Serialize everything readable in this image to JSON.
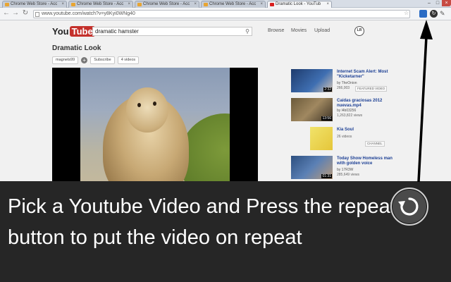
{
  "browser": {
    "tabs": [
      {
        "label": "Chrome Web Store - Acc",
        "active": false
      },
      {
        "label": "Chrome Web Store - Acc",
        "active": false
      },
      {
        "label": "Chrome Web Store - Acc",
        "active": false
      },
      {
        "label": "Chrome Web Store - Acc",
        "active": false
      },
      {
        "label": "Dramatic Look - YouTub",
        "active": true
      }
    ],
    "tab_close_glyph": "×",
    "url": "www.youtube.com/watch?v=y8Kyi0WNg40",
    "icons": {
      "back": "back-arrow-icon",
      "forward": "forward-arrow-icon",
      "reload": "reload-icon",
      "page": "page-icon",
      "bookmark": "star-icon",
      "extension1": "extension-icon",
      "extension2": "repeat-extension-icon",
      "menu": "wrench-icon"
    }
  },
  "youtube": {
    "logo_you": "You",
    "logo_tube": "Tube",
    "search_value": "dramatic hamster",
    "nav": [
      "Browse",
      "Movies",
      "Upload"
    ],
    "account_initials": "LR",
    "video_title": "Dramatic Look",
    "channel": "magnets99",
    "subscribe": "Subscribe",
    "videos_count": "4 videos",
    "related": [
      {
        "title": "Internet Scam Alert: Most \"Kicketarner\"",
        "by": "by TheOnion",
        "views": "266,003",
        "badge": "FEATURED VIDEO",
        "duration": "2:32"
      },
      {
        "title": "Caídas graciosas 2012 nuevas.mp4",
        "by": "by l4b03256",
        "views": "1,263,822 views",
        "badge": "",
        "duration": "13:56"
      },
      {
        "title": "Kia Soul",
        "by": "",
        "views": "26 videos",
        "badge": "CHANNEL",
        "duration": ""
      },
      {
        "title": "Today Show Homeless man with golden voice",
        "by": "by 17R3W",
        "views": "285,649 views",
        "badge": "",
        "duration": "01:31"
      }
    ]
  },
  "overlay": {
    "caption": "Pick a Youtube Video and Press the repeat button to put the video on repeat",
    "repeat_icon": "repeat-icon",
    "arrow_icon": "arrow-icon"
  },
  "colors": {
    "overlay_bg": "#262626",
    "youtube_red": "#c4302b",
    "link_blue": "#1c3f94"
  }
}
